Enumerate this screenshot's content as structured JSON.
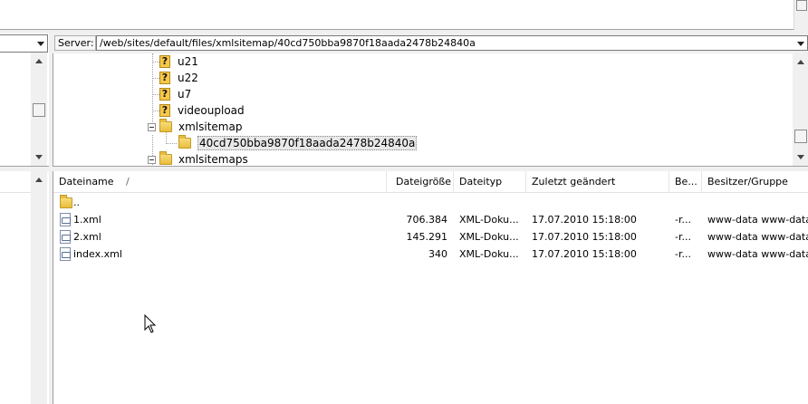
{
  "server_bar": {
    "label": "Server:",
    "path": "/web/sites/default/files/xmlsitemap/40cd750bba9870f18aada2478b24840a"
  },
  "tree": [
    {
      "label": "u21",
      "icon": "unknown-folder-icon"
    },
    {
      "label": "u22",
      "icon": "unknown-folder-icon"
    },
    {
      "label": "u7",
      "icon": "unknown-folder-icon"
    },
    {
      "label": "videoupload",
      "icon": "unknown-folder-icon"
    },
    {
      "label": "xmlsitemap",
      "icon": "folder-icon",
      "expanded": true
    },
    {
      "label": "40cd750bba9870f18aada2478b24840a",
      "icon": "folder-icon",
      "selected": true
    },
    {
      "label": "xmlsitemaps",
      "icon": "folder-icon"
    }
  ],
  "file_list": {
    "columns": [
      "Dateiname",
      "Dateigröße",
      "Dateityp",
      "Zuletzt geändert",
      "Be...",
      "Besitzer/Gruppe"
    ],
    "sort_indicator": "/",
    "parent_dir_label": "..",
    "rows": [
      {
        "name": "1.xml",
        "size": "706.384",
        "type": "XML-Doku...",
        "modified": "17.07.2010 15:18:00",
        "perms": "-r...",
        "owner": "www-data www-data"
      },
      {
        "name": "2.xml",
        "size": "145.291",
        "type": "XML-Doku...",
        "modified": "17.07.2010 15:18:00",
        "perms": "-r...",
        "owner": "www-data www-data"
      },
      {
        "name": "index.xml",
        "size": "340",
        "type": "XML-Doku...",
        "modified": "17.07.2010 15:18:00",
        "perms": "-r...",
        "owner": "www-data www-data"
      }
    ]
  },
  "colors": {
    "pane_bg": "#ffffff",
    "chrome_bg": "#f0f0f0",
    "folder": "#e9bd3b",
    "selection": "#e8e8e8"
  }
}
